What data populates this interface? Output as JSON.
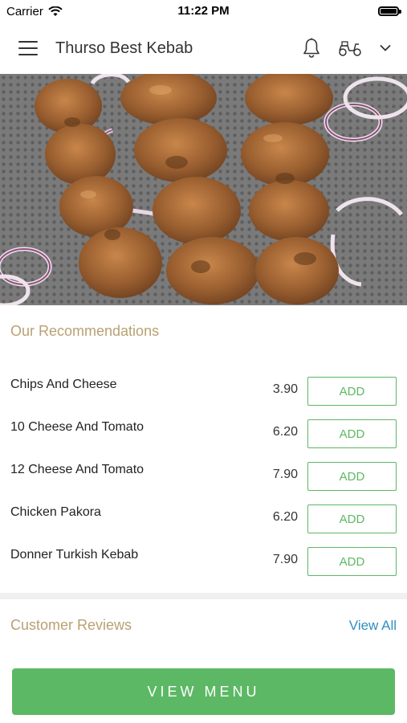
{
  "status_bar": {
    "carrier": "Carrier",
    "time": "11:22 PM"
  },
  "header": {
    "title": "Thurso Best Kebab"
  },
  "hero": {
    "description_icon": "kebab-skewers-photo"
  },
  "recommendations": {
    "title": "Our Recommendations",
    "items": [
      {
        "name": "Chips And Cheese",
        "price": "3.90",
        "button": "ADD"
      },
      {
        "name": "10 Cheese And Tomato",
        "price": "6.20",
        "button": "ADD"
      },
      {
        "name": "12 Cheese And Tomato",
        "price": "7.90",
        "button": "ADD"
      },
      {
        "name": "Chicken Pakora",
        "price": "6.20",
        "button": "ADD"
      },
      {
        "name": "Donner Turkish Kebab",
        "price": "7.90",
        "button": "ADD"
      }
    ]
  },
  "reviews": {
    "title": "Customer Reviews",
    "view_all": "View All"
  },
  "footer": {
    "view_menu": "VIEW MENU"
  },
  "colors": {
    "accent_green": "#5cb865",
    "section_title": "#b9a173",
    "link_blue": "#2f8fc0"
  }
}
